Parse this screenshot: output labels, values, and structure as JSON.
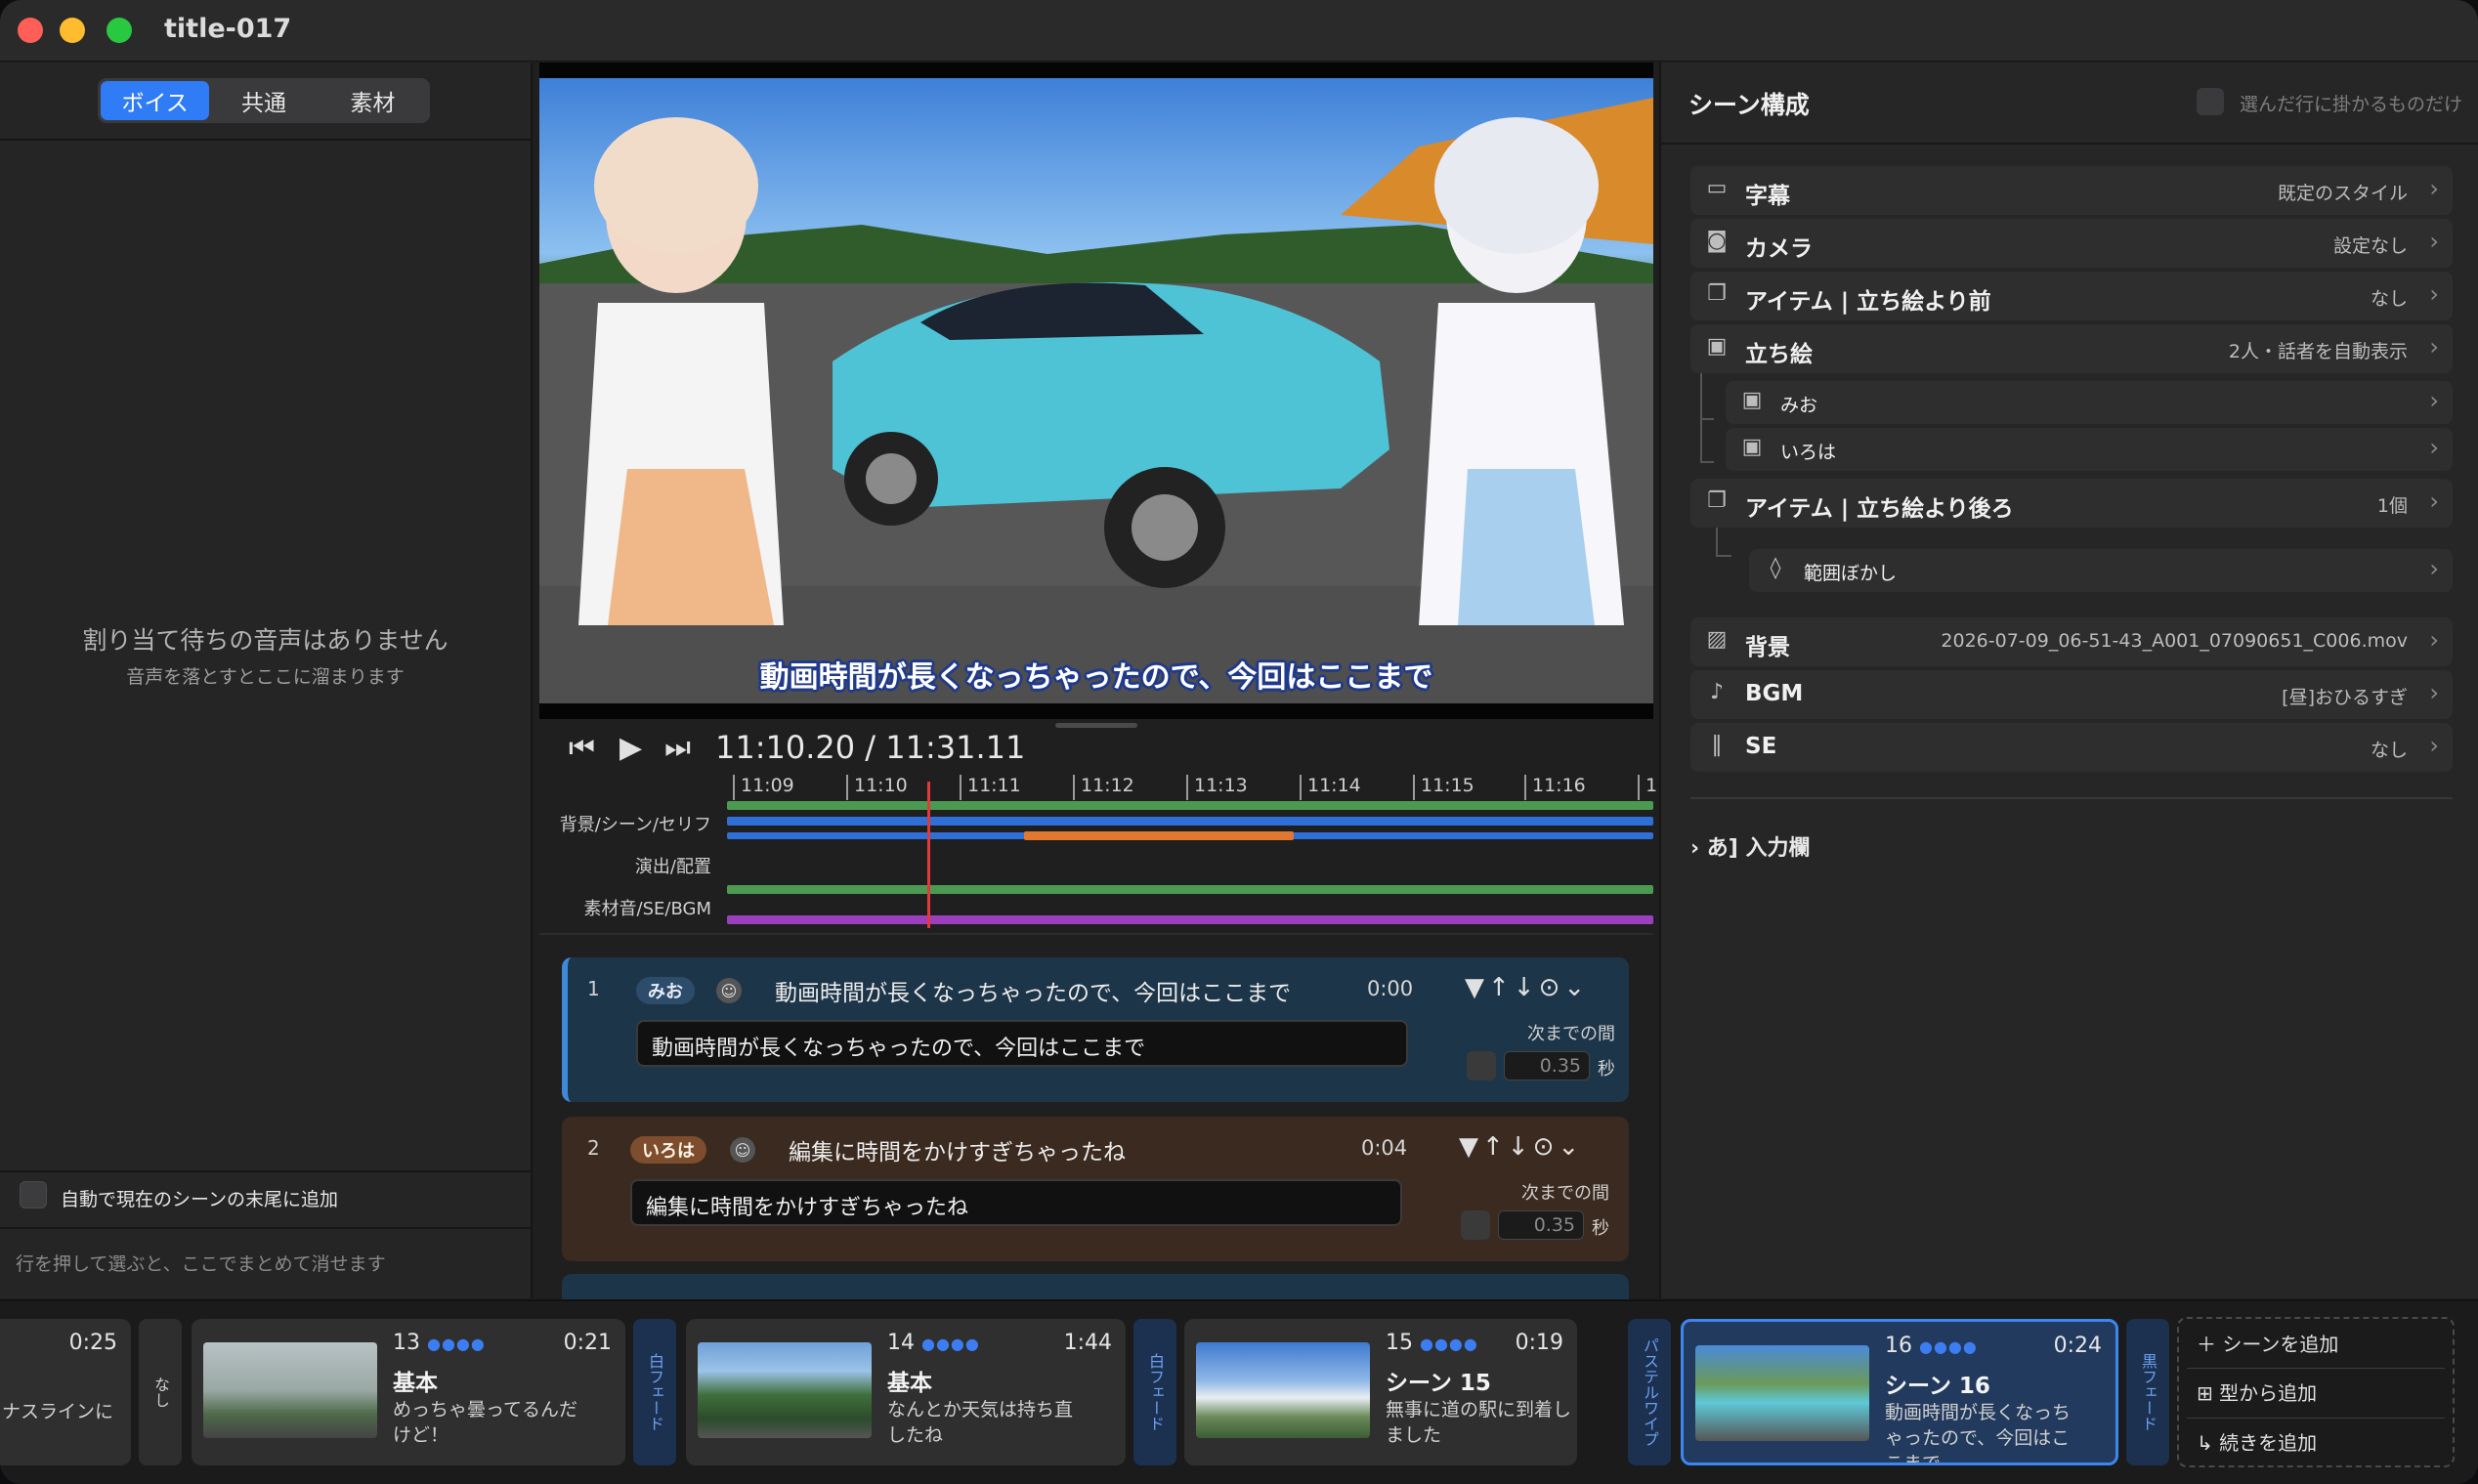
{
  "window": {
    "title": "title-017"
  },
  "left_panel": {
    "tabs": [
      {
        "label": "ボイス",
        "active": true
      },
      {
        "label": "共通",
        "active": false
      },
      {
        "label": "素材",
        "active": false
      }
    ],
    "empty_title": "割り当て待ちの音声はありません",
    "empty_subtitle": "音声を落とすとここに溜まります",
    "auto_add_label": "自動で現在のシーンの末尾に追加",
    "hint": "行を押して選ぶと、ここでまとめて消せます"
  },
  "preview": {
    "caption": "動画時間が長くなっちゃったので、今回はここまで"
  },
  "transport": {
    "current_time": "11:10.20",
    "separator": "/",
    "total_time": "11:31.11"
  },
  "timeline": {
    "ticks": [
      "11:09",
      "11:10",
      "11:11",
      "11:12",
      "11:13",
      "11:14",
      "11:15",
      "11:16",
      "1"
    ],
    "tracks": [
      "背景/シーン/セリフ",
      "演出/配置",
      "素材音/SE/BGM"
    ],
    "colors": {
      "green": "#4c9a52",
      "blue": "#2f6fd8",
      "orange": "#e0782f",
      "purple": "#9b3fbf",
      "playhead": "#e03a3a"
    }
  },
  "rows": [
    {
      "index": "1",
      "speaker": "みお",
      "text": "動画時間が長くなっちゃったので、今回はここまで",
      "time": "0:00",
      "input": "動画時間が長くなっちゃったので、今回はここまで",
      "next_label": "次までの間",
      "gap": "0.35",
      "unit": "秒"
    },
    {
      "index": "2",
      "speaker": "いろは",
      "text": "編集に時間をかけすぎちゃったね",
      "time": "0:04",
      "input": "編集に時間をかけすぎちゃったね",
      "next_label": "次までの間",
      "gap": "0.35",
      "unit": "秒"
    }
  ],
  "right_panel": {
    "title": "シーン構成",
    "checkbox_label": "選んだ行に掛かるものだけ",
    "items": [
      {
        "label": "字幕",
        "value": "既定のスタイル",
        "icon": "caption-icon"
      },
      {
        "label": "カメラ",
        "value": "設定なし",
        "icon": "camera-icon"
      },
      {
        "label": "アイテム | 立ち絵より前",
        "value": "なし",
        "icon": "layers-icon"
      },
      {
        "label": "立ち絵",
        "value": "2人・話者を自動表示",
        "icon": "portrait-icon"
      },
      {
        "label": "みお",
        "value": "",
        "icon": "portrait-icon"
      },
      {
        "label": "いろは",
        "value": "",
        "icon": "portrait-icon"
      },
      {
        "label": "アイテム | 立ち絵より後ろ",
        "value": "1個",
        "icon": "layers-icon"
      },
      {
        "label": "範囲ぼかし",
        "value": "",
        "icon": "drop-icon"
      },
      {
        "label": "背景",
        "value": "2026-07-09_06-51-43_A001_07090651_C006.mov",
        "icon": "image-icon"
      },
      {
        "label": "BGM",
        "value": "[昼]おひるすぎ",
        "icon": "music-icon"
      },
      {
        "label": "SE",
        "value": "なし",
        "icon": "waveform-icon"
      }
    ],
    "input_section": "あ] 入力欄"
  },
  "scenes": {
    "partial": {
      "duration": "0:25",
      "text": "ナスラインに"
    },
    "transitions": [
      "なし",
      "白フェード",
      "白フェード",
      "パステルワイプ",
      "黒フェード"
    ],
    "cards": [
      {
        "number": "13",
        "dots": "●●●●",
        "duration": "0:21",
        "name": "基本",
        "desc": "めっちゃ曇ってるんだけど！"
      },
      {
        "number": "14",
        "dots": "●●●●",
        "duration": "1:44",
        "name": "基本",
        "desc": "なんとか天気は持ち直したね"
      },
      {
        "number": "15",
        "dots": "●●●●",
        "duration": "0:19",
        "name": "シーン 15",
        "desc": "無事に道の駅に到着しました"
      },
      {
        "number": "16",
        "dots": "●●●●",
        "duration": "0:24",
        "name": "シーン 16",
        "desc": "動画時間が長くなっちゃったので、今回はここまで"
      }
    ],
    "add_actions": [
      "シーンを追加",
      "型から追加",
      "続きを追加"
    ]
  }
}
